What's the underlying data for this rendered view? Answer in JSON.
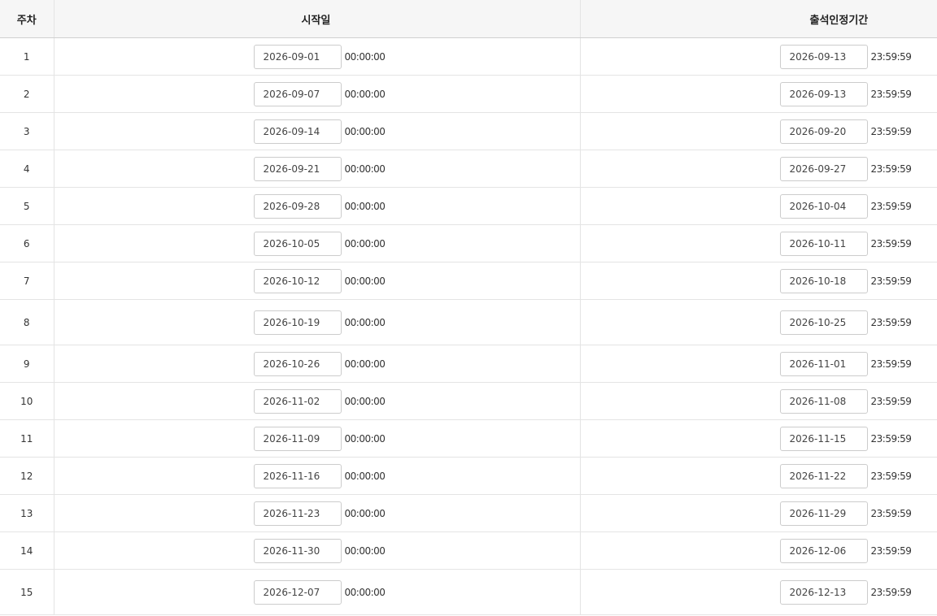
{
  "table": {
    "headers": {
      "week": "주차",
      "start": "시작일",
      "attendance": "출석인정기간"
    },
    "rows": [
      {
        "week": "1",
        "start_date": "2026-09-01",
        "start_time": "00:00:00",
        "end_date": "2026-09-13",
        "end_time": "23:59:59"
      },
      {
        "week": "2",
        "start_date": "2026-09-07",
        "start_time": "00:00:00",
        "end_date": "2026-09-13",
        "end_time": "23:59:59"
      },
      {
        "week": "3",
        "start_date": "2026-09-14",
        "start_time": "00:00:00",
        "end_date": "2026-09-20",
        "end_time": "23:59:59"
      },
      {
        "week": "4",
        "start_date": "2026-09-21",
        "start_time": "00:00:00",
        "end_date": "2026-09-27",
        "end_time": "23:59:59"
      },
      {
        "week": "5",
        "start_date": "2026-09-28",
        "start_time": "00:00:00",
        "end_date": "2026-10-04",
        "end_time": "23:59:59"
      },
      {
        "week": "6",
        "start_date": "2026-10-05",
        "start_time": "00:00:00",
        "end_date": "2026-10-11",
        "end_time": "23:59:59"
      },
      {
        "week": "7",
        "start_date": "2026-10-12",
        "start_time": "00:00:00",
        "end_date": "2026-10-18",
        "end_time": "23:59:59"
      },
      {
        "week": "8",
        "start_date": "2026-10-19",
        "start_time": "00:00:00",
        "end_date": "2026-10-25",
        "end_time": "23:59:59"
      },
      {
        "week": "9",
        "start_date": "2026-10-26",
        "start_time": "00:00:00",
        "end_date": "2026-11-01",
        "end_time": "23:59:59"
      },
      {
        "week": "10",
        "start_date": "2026-11-02",
        "start_time": "00:00:00",
        "end_date": "2026-11-08",
        "end_time": "23:59:59"
      },
      {
        "week": "11",
        "start_date": "2026-11-09",
        "start_time": "00:00:00",
        "end_date": "2026-11-15",
        "end_time": "23:59:59"
      },
      {
        "week": "12",
        "start_date": "2026-11-16",
        "start_time": "00:00:00",
        "end_date": "2026-11-22",
        "end_time": "23:59:59"
      },
      {
        "week": "13",
        "start_date": "2026-11-23",
        "start_time": "00:00:00",
        "end_date": "2026-11-29",
        "end_time": "23:59:59"
      },
      {
        "week": "14",
        "start_date": "2026-11-30",
        "start_time": "00:00:00",
        "end_date": "2026-12-06",
        "end_time": "23:59:59"
      },
      {
        "week": "15",
        "start_date": "2026-12-07",
        "start_time": "00:00:00",
        "end_date": "2026-12-13",
        "end_time": "23:59:59"
      }
    ]
  }
}
